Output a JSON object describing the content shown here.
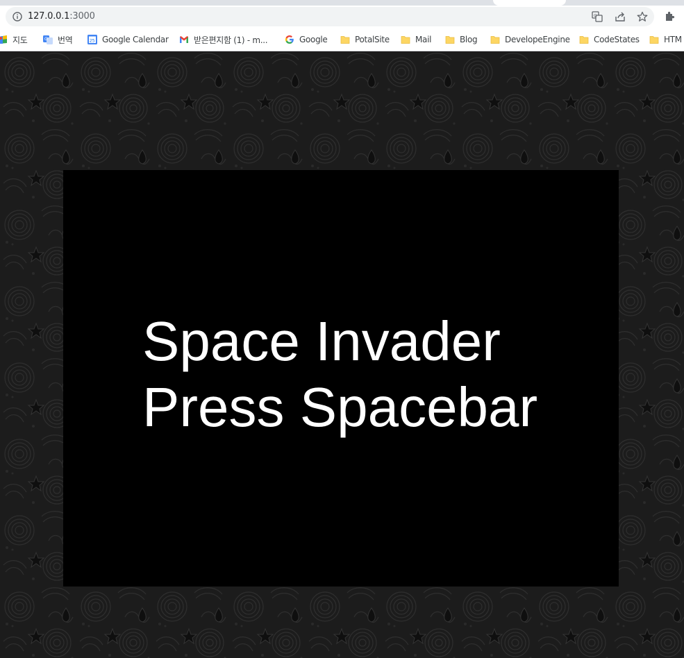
{
  "browser": {
    "url_host": "127.0.0.1",
    "url_port": ":3000",
    "bookmarks": [
      {
        "label": "지도",
        "icon": "maps-icon"
      },
      {
        "label": "번역",
        "icon": "translate-icon"
      },
      {
        "label": "Google Calendar",
        "icon": "calendar-icon",
        "icon_text": "25"
      },
      {
        "label": "받은편지함 (1) - m...",
        "icon": "gmail-icon"
      },
      {
        "label": "Google",
        "icon": "google-icon"
      },
      {
        "label": "PotalSite",
        "icon": "folder-icon"
      },
      {
        "label": "Mail",
        "icon": "folder-icon"
      },
      {
        "label": "Blog",
        "icon": "folder-icon"
      },
      {
        "label": "DevelopeEngine",
        "icon": "folder-icon"
      },
      {
        "label": "CodeStates",
        "icon": "folder-icon"
      },
      {
        "label": "HTM",
        "icon": "folder-icon"
      }
    ]
  },
  "game": {
    "title": "Space Invader",
    "prompt": "Press Spacebar"
  },
  "colors": {
    "canvas": "#000000",
    "text": "#ffffff",
    "background_pattern": "#1c1c1c",
    "folder": "#fdd663"
  }
}
